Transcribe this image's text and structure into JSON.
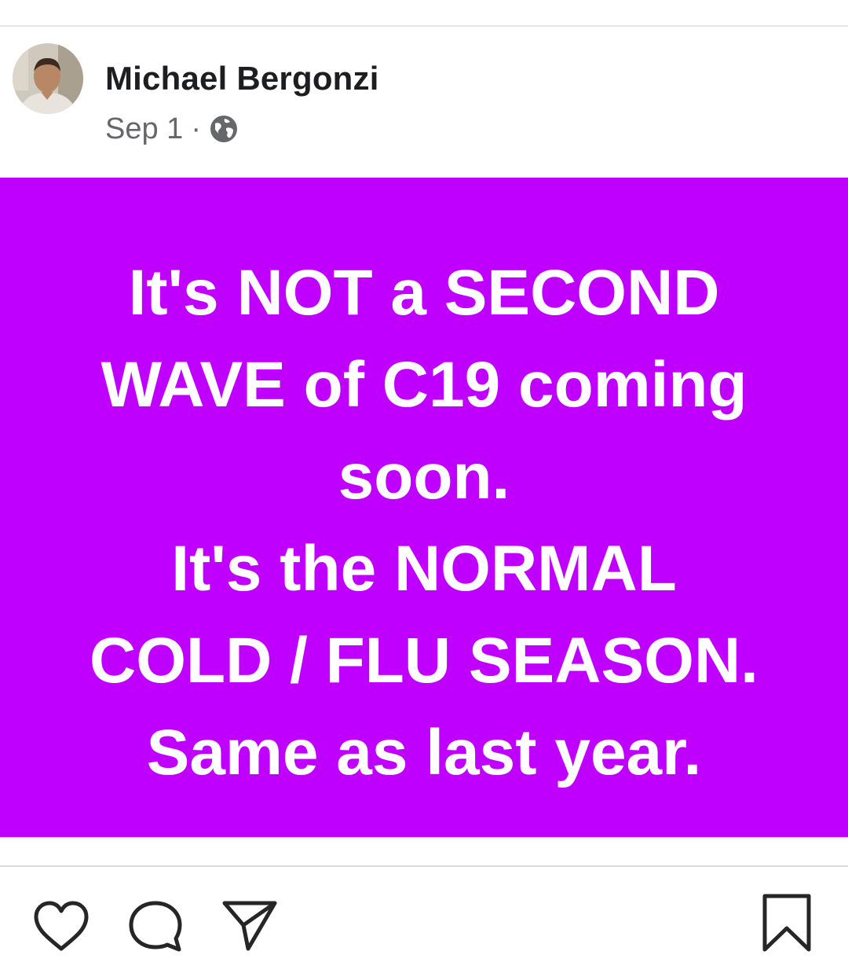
{
  "post": {
    "author": "Michael Bergonzi",
    "date": "Sep 1",
    "separator": "·",
    "privacy_icon": "globe-icon",
    "image": {
      "background": "#bf00ff",
      "text_color": "#ffffff",
      "lines": [
        "It's NOT a SECOND",
        "WAVE of C19 coming",
        "soon.",
        "It's the NORMAL",
        "COLD / FLU SEASON.",
        "Same as last year."
      ]
    }
  },
  "actions": {
    "icons": [
      "heart-icon",
      "comment-icon",
      "share-icon",
      "bookmark-icon"
    ]
  }
}
